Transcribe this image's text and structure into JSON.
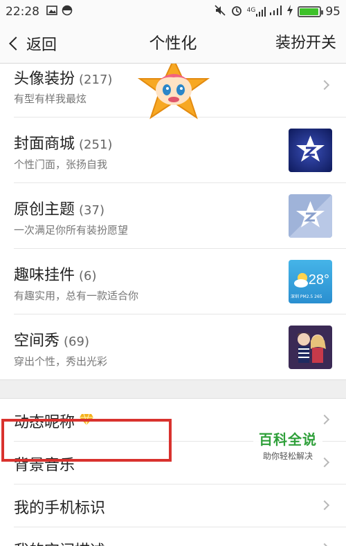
{
  "status_bar": {
    "time": "22:28",
    "network": "4G",
    "battery_level": 95,
    "battery_text": "95",
    "colors": {
      "battery": "#3ec12a"
    }
  },
  "nav": {
    "back_label": "返回",
    "title": "个性化",
    "right_action": "装扮开关"
  },
  "items": [
    {
      "title": "头像装扮",
      "count": "(217)",
      "subtitle": "有型有样我最炫",
      "thumb": "mascot-avatar"
    },
    {
      "title": "封面商城",
      "count": "(251)",
      "subtitle": "个性门面，张扬自我",
      "thumb": "qzone-star-dark"
    },
    {
      "title": "原创主题",
      "count": "(37)",
      "subtitle": "一次满足你所有装扮愿望",
      "thumb": "qzone-star-light"
    },
    {
      "title": "趣味挂件",
      "count": "(6)",
      "subtitle": "有趣实用，总有一款适合你",
      "thumb": "weather-widget",
      "thumb_temp": "28°",
      "thumb_text": "深圳 PM2.5 265"
    },
    {
      "title": "空间秀",
      "count": "(69)",
      "subtitle": "穿出个性，秀出光彩",
      "thumb": "couple-avatar"
    }
  ],
  "settings": [
    {
      "title": "动态昵称",
      "icon": "diamond-icon"
    },
    {
      "title": "背景音乐"
    },
    {
      "title": "我的手机标识"
    },
    {
      "title": "我的空间描述"
    }
  ],
  "watermark": {
    "title": "百科全说",
    "subtitle": "助你轻松解决"
  }
}
